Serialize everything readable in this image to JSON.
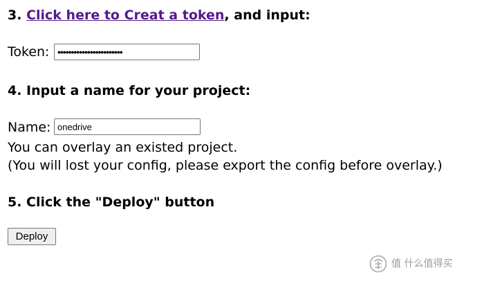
{
  "step3": {
    "number": "3. ",
    "link_text": "Click here to Creat a token",
    "suffix": ", and input:"
  },
  "token": {
    "label": "Token:",
    "value": "••••••••••••••••••••••••"
  },
  "step4": {
    "heading": "4. Input a name for your project:"
  },
  "name": {
    "label": "Name:",
    "value": "onedrive"
  },
  "notes": {
    "line1": "You can overlay an existed project.",
    "line2": "(You will lost your config, please export the config before overlay.)"
  },
  "step5": {
    "heading": "5. Click the \"Deploy\" button"
  },
  "deploy": {
    "label": "Deploy"
  },
  "watermark": {
    "text": "值 什么值得买",
    "icon": "watermark-logo-icon"
  },
  "colors": {
    "link": "#551a8b",
    "text": "#000000",
    "button_bg": "#efefef",
    "watermark": "#8a8a8a"
  }
}
